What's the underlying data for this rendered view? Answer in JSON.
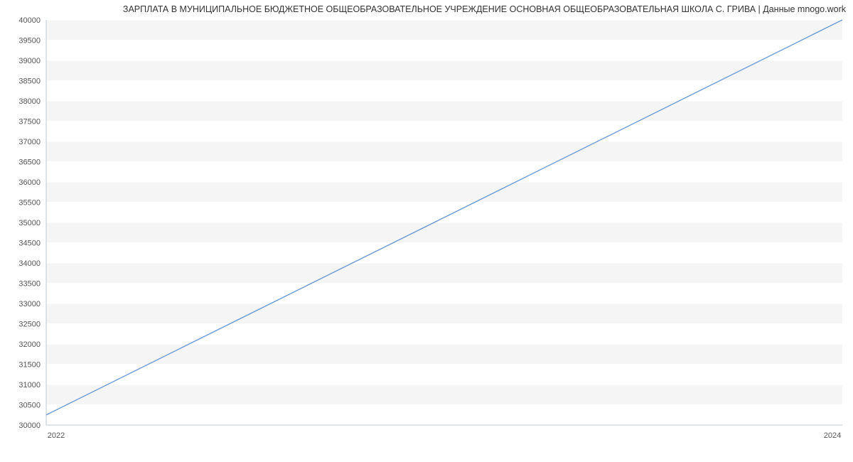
{
  "chart_data": {
    "type": "line",
    "title": "ЗАРПЛАТА В МУНИЦИПАЛЬНОЕ БЮДЖЕТНОЕ ОБЩЕОБРАЗОВАТЕЛЬНОЕ УЧРЕЖДЕНИЕ ОСНОВНАЯ ОБЩЕОБРАЗОВАТЕЛЬНАЯ ШКОЛА С. ГРИВА | Данные mnogo.work",
    "x": [
      2022,
      2024
    ],
    "values": [
      30250,
      40000
    ],
    "xlabel": "",
    "ylabel": "",
    "xlim": [
      2022,
      2024
    ],
    "ylim": [
      30000,
      40000
    ],
    "y_ticks": [
      30000,
      30500,
      31000,
      31500,
      32000,
      32500,
      33000,
      33500,
      34000,
      34500,
      35000,
      35500,
      36000,
      36500,
      37000,
      37500,
      38000,
      38500,
      39000,
      39500,
      40000
    ],
    "x_ticks": [
      2022,
      2024
    ],
    "grid": true,
    "colors": {
      "line": "#6e9bd6",
      "band": "#f5f5f5",
      "axis": "#bfc8d1"
    }
  }
}
